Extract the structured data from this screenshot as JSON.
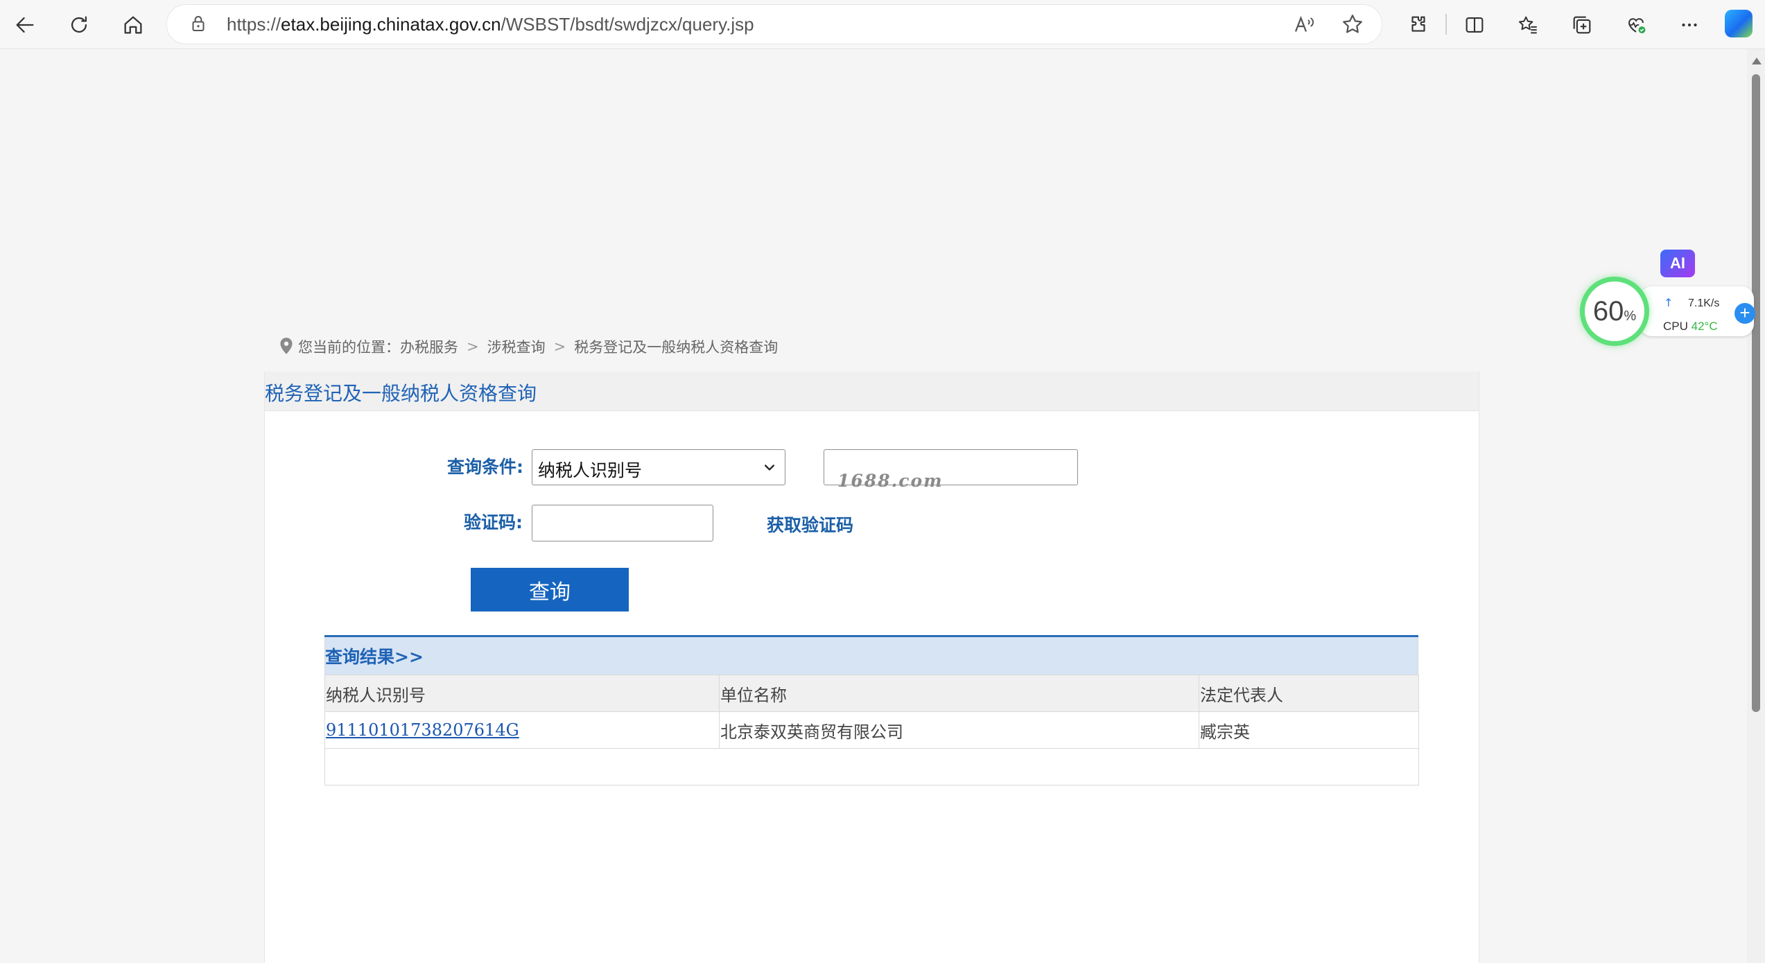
{
  "browser": {
    "url_scheme": "https://",
    "url_host": "etax.beijing.chinatax.gov.cn",
    "url_path": "/WSBST/bsdt/swdjzcx/query.jsp"
  },
  "widgets": {
    "ai_label": "AI",
    "cpu_usage": "60",
    "cpu_unit": "%",
    "net_speed": "7.1K/s",
    "cpu_label": "CPU",
    "cpu_temp": "42°C",
    "plus_label": "+"
  },
  "breadcrumb": {
    "prefix": "您当前的位置：",
    "items": [
      "办税服务",
      "涉税查询",
      "税务登记及一般纳税人资格查询"
    ],
    "separator": ">"
  },
  "page": {
    "title": "税务登记及一般纳税人资格查询"
  },
  "form": {
    "condition_label": "查询条件:",
    "condition_selected": "纳税人识别号",
    "captcha_label": "验证码:",
    "get_captcha": "获取验证码",
    "watermark": "1688.com",
    "submit_label": "查询"
  },
  "results": {
    "header": "查询结果>>",
    "columns": [
      "纳税人识别号",
      "单位名称",
      "法定代表人"
    ],
    "rows": [
      [
        "91110101738207614G",
        "北京泰双英商贸有限公司",
        "臧宗英"
      ]
    ]
  },
  "colors": {
    "accent": "#1565c0",
    "title": "#1f62b6",
    "label": "#1b5fa8",
    "result_header_bg": "#d6e4f4"
  }
}
